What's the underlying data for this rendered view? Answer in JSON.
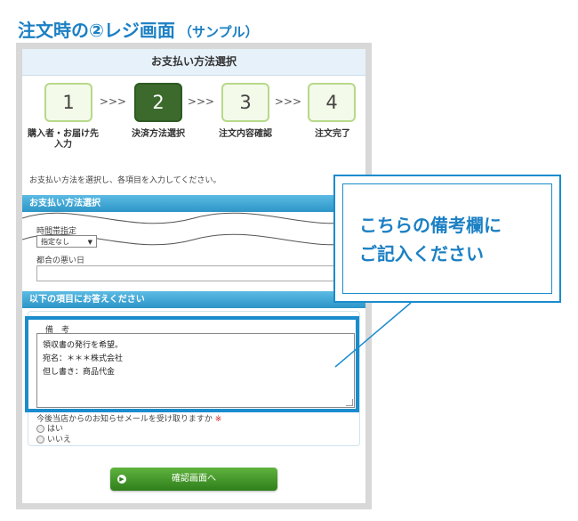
{
  "heading": {
    "main": "注文時の②レジ画面",
    "sub": "（サンプル）"
  },
  "page": {
    "title": "お支払い方法選択"
  },
  "steps": [
    {
      "number": "1",
      "label": "購入者・お届け先\n入力"
    },
    {
      "number": "2",
      "label": "決済方法選択"
    },
    {
      "number": "3",
      "label": "注文内容確認"
    },
    {
      "number": "4",
      "label": "注文完了"
    }
  ],
  "step_arrow": ">>>",
  "intro": "お支払い方法を選択し、各項目を入力してください。",
  "payment_section": {
    "title": "お支払い方法選択",
    "time_label": "時間帯指定",
    "time_value": "指定なし",
    "bad_day_label": "都合の悪い日"
  },
  "questions_section": {
    "title": "以下の項目にお答えください",
    "remarks_label": "備　考",
    "remarks_lines": [
      "領収書の発行を希望。",
      "宛名：＊＊＊株式会社",
      "但し書き：商品代金"
    ],
    "newsletter_question": "今後当店からのお知らせメールを受け取りますか",
    "required_mark": "※",
    "options": [
      "はい",
      "いいえ"
    ]
  },
  "confirm_button": "確認画面へ",
  "callout": {
    "lines": [
      "こちらの備考欄に",
      "ご記入ください"
    ]
  },
  "colors": {
    "accent": "#1a8ccd",
    "active_step": "#3b6a2c",
    "step_border": "#b6d98a",
    "button": "#3f9226"
  }
}
